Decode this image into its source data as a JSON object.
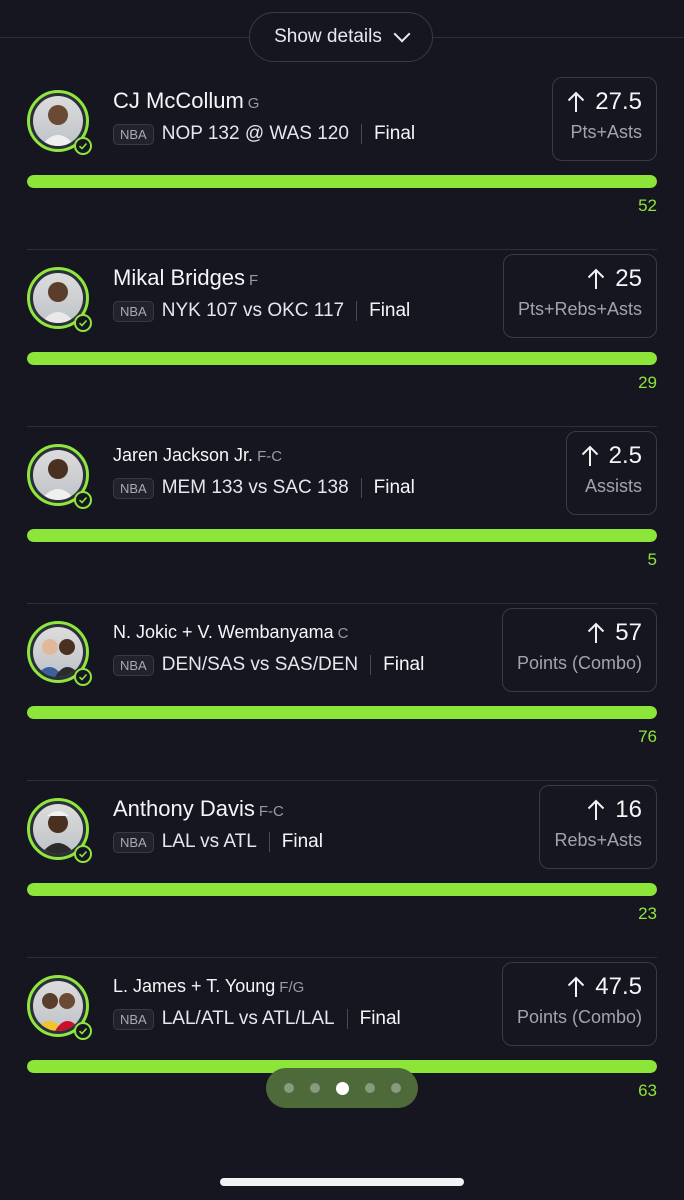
{
  "header": {
    "details_label": "Show details"
  },
  "pager": {
    "count": 5,
    "active": 2
  },
  "cards": [
    {
      "name": "CJ McCollum",
      "pos": "G",
      "league": "NBA",
      "matchup": "NOP 132 @ WAS 120",
      "status": "Final",
      "line": "27.5",
      "stat": "Pts+Asts",
      "actual": "52",
      "progress": 1.0
    },
    {
      "name": "Mikal Bridges",
      "pos": "F",
      "league": "NBA",
      "matchup": "NYK 107 vs OKC 117",
      "status": "Final",
      "line": "25",
      "stat": "Pts+Rebs+Asts",
      "actual": "29",
      "progress": 1.0
    },
    {
      "name": "Jaren Jackson Jr.",
      "pos": "F-C",
      "league": "NBA",
      "matchup": "MEM 133 vs SAC 138",
      "status": "Final",
      "line": "2.5",
      "stat": "Assists",
      "actual": "5",
      "progress": 1.0
    },
    {
      "name": "N. Jokic + V. Wembanyama",
      "pos": "C",
      "league": "NBA",
      "matchup": "DEN/SAS vs SAS/DEN",
      "status": "Final",
      "line": "57",
      "stat": "Points (Combo)",
      "actual": "76",
      "progress": 1.0
    },
    {
      "name": "Anthony Davis",
      "pos": "F-C",
      "league": "NBA",
      "matchup": "LAL vs ATL",
      "status": "Final",
      "line": "16",
      "stat": "Rebs+Asts",
      "actual": "23",
      "progress": 1.0
    },
    {
      "name": "L. James + T. Young",
      "pos": "F/G",
      "league": "NBA",
      "matchup": "LAL/ATL vs ATL/LAL",
      "status": "Final",
      "line": "47.5",
      "stat": "Points (Combo)",
      "actual": "63",
      "progress": 1.0
    }
  ],
  "colors": {
    "accent": "#8de539",
    "background": "#161620",
    "border": "#3a3a46"
  }
}
